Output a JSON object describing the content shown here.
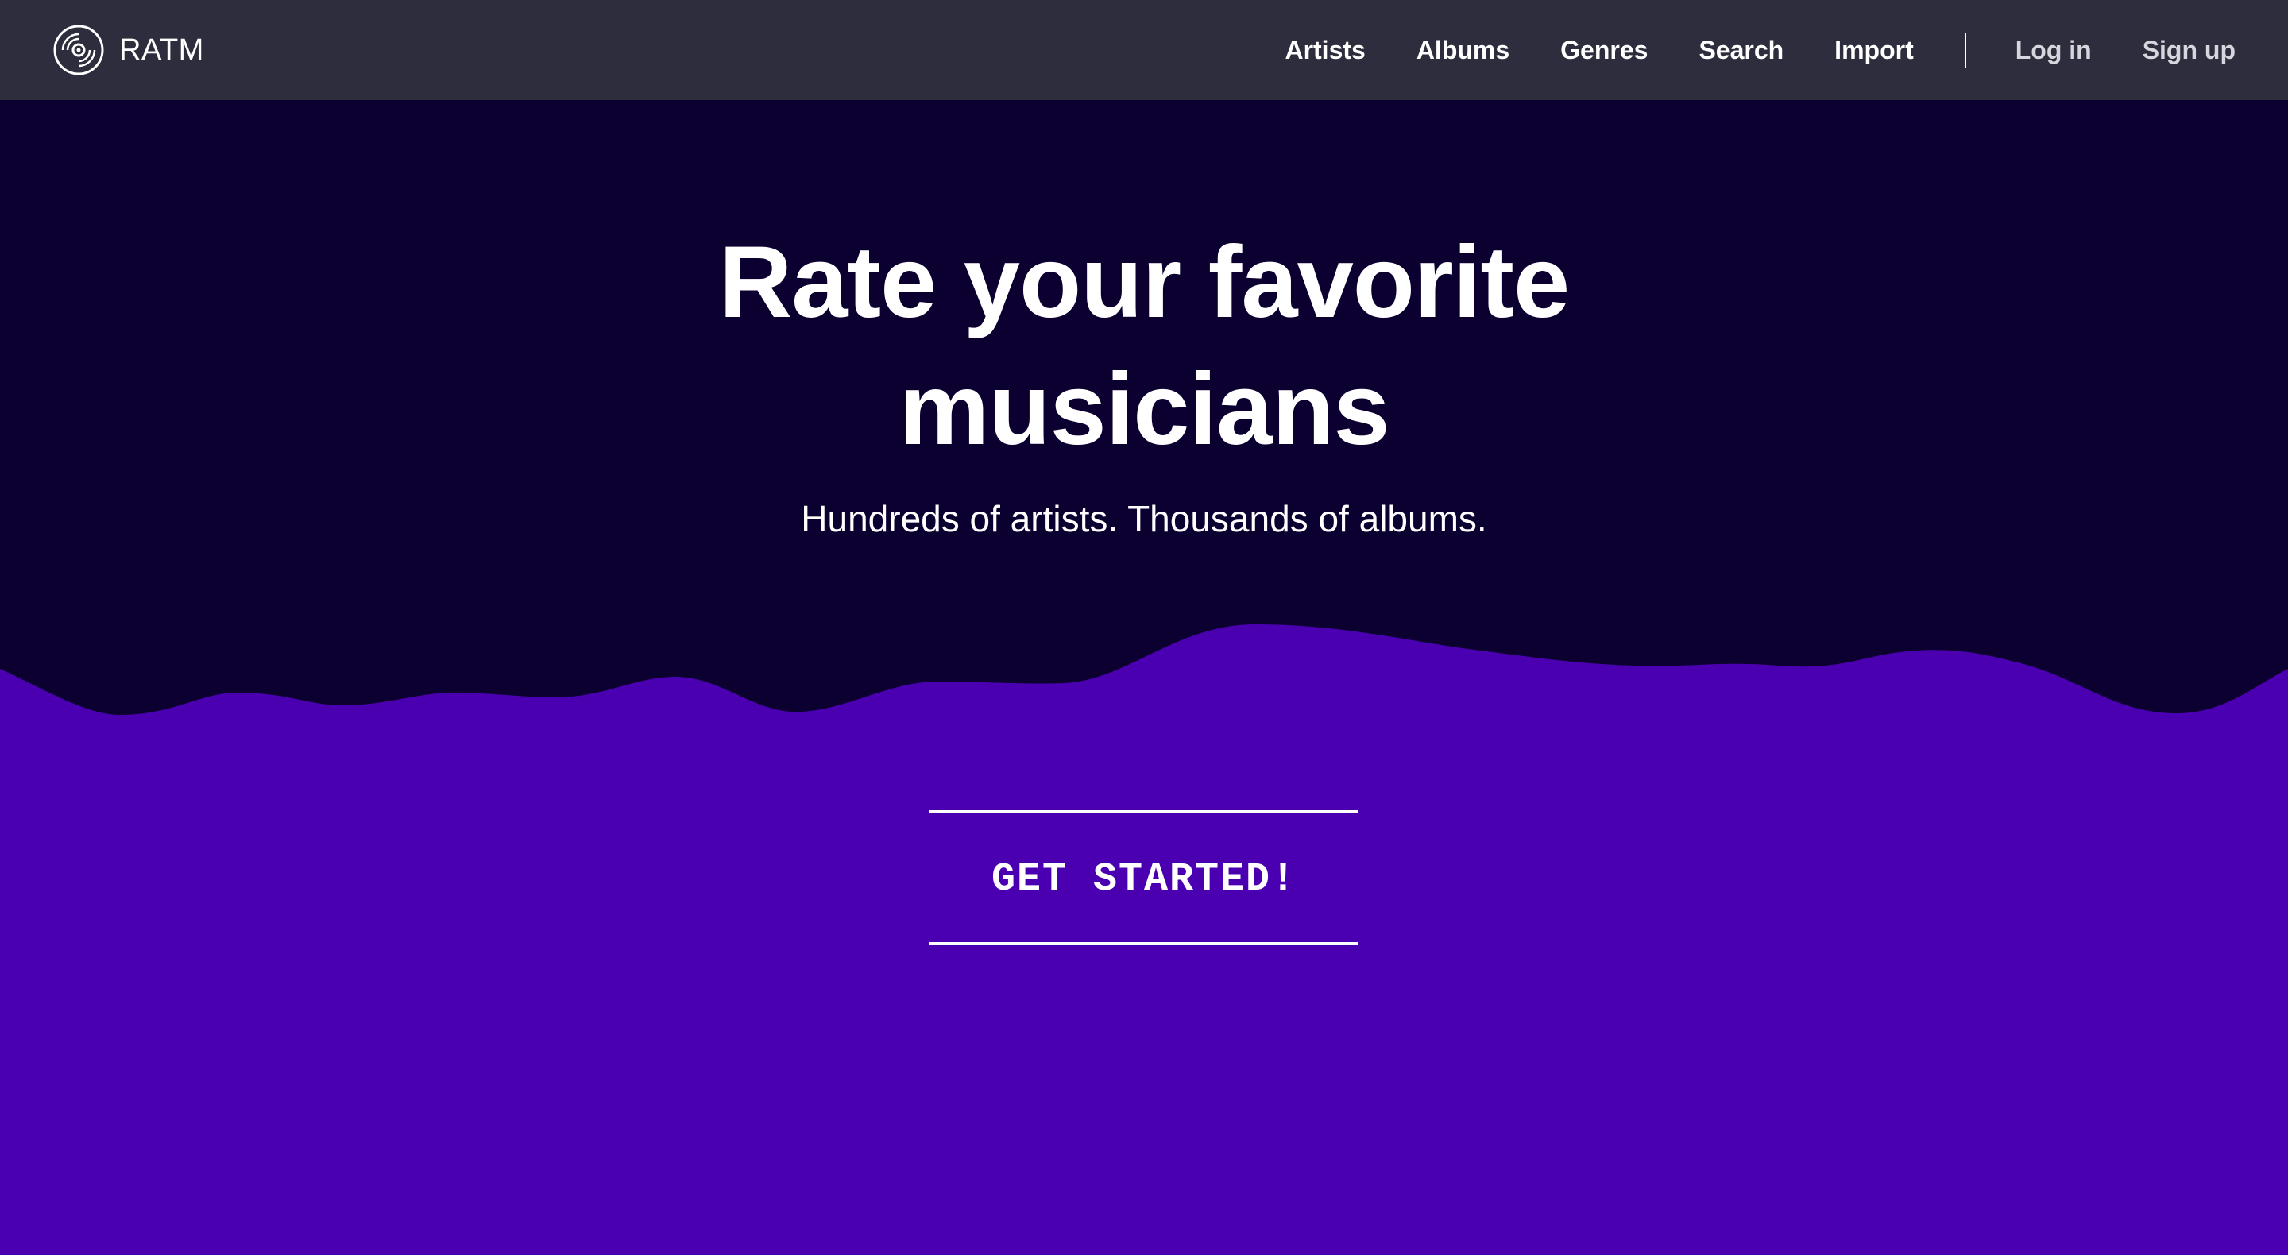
{
  "brand": {
    "name": "RATM",
    "logo_icon": "vinyl-record-icon"
  },
  "nav": {
    "links": [
      {
        "label": "Artists"
      },
      {
        "label": "Albums"
      },
      {
        "label": "Genres"
      },
      {
        "label": "Search"
      },
      {
        "label": "Import"
      }
    ],
    "auth": {
      "login_label": "Log in",
      "signup_label": "Sign up"
    }
  },
  "hero": {
    "title_line1": "Rate your favorite",
    "title_line2": "musicians",
    "subtitle": "Hundreds of artists. Thousands of albums."
  },
  "cta": {
    "label": "GET STARTED!"
  },
  "colors": {
    "navbar_bg": "#2d2d3d",
    "hero_bg": "#0c0030",
    "accent_purple": "#4a00b0",
    "text": "#ffffff"
  }
}
